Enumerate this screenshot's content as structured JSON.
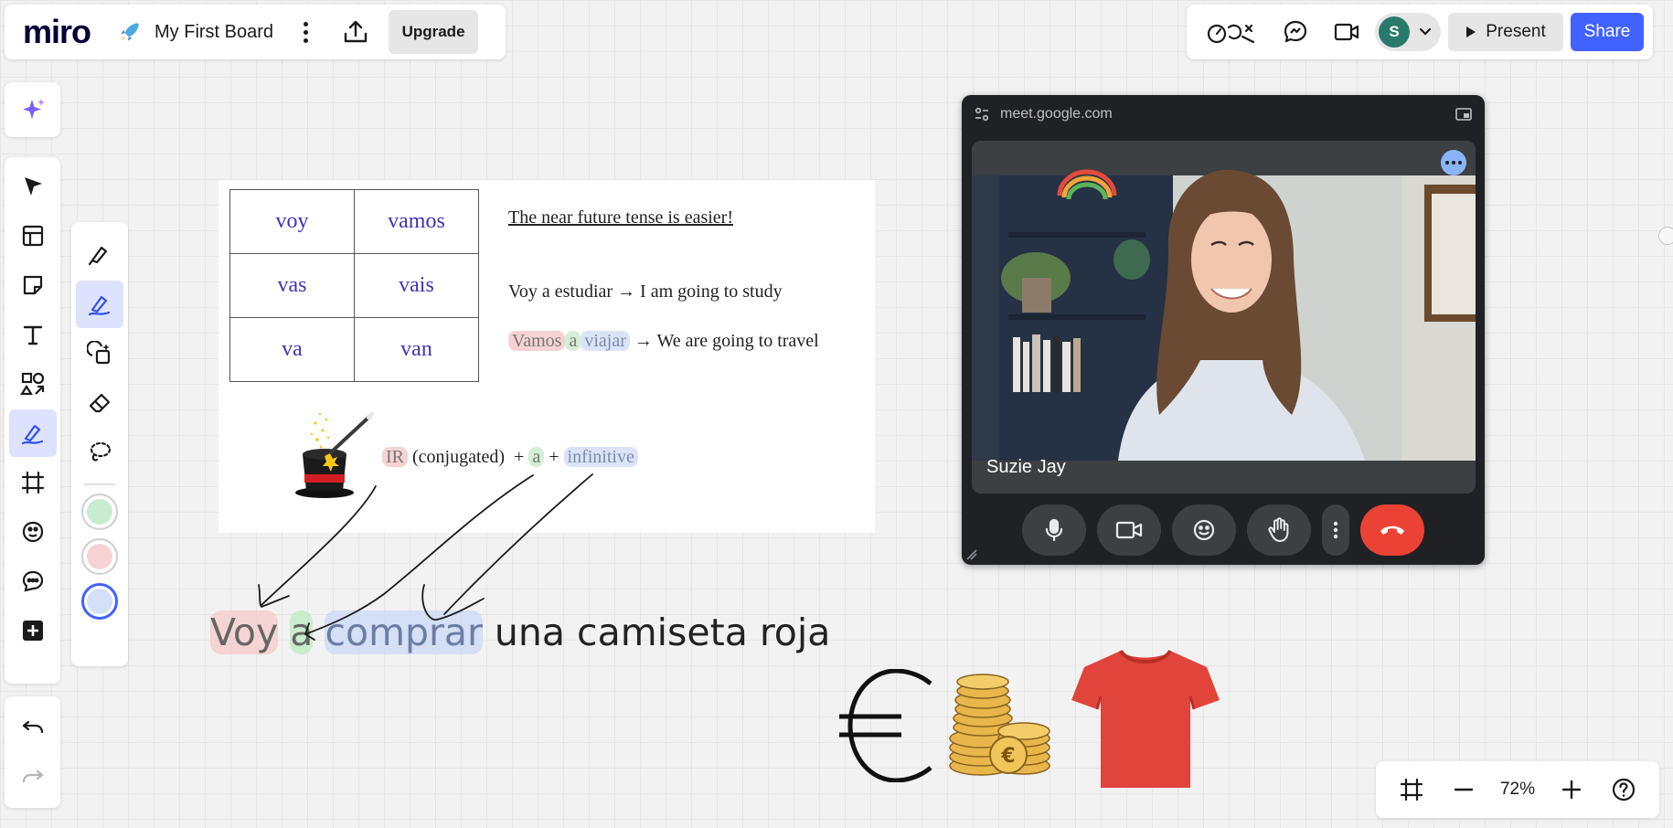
{
  "app": {
    "logo": "miro",
    "board_name": "My First Board",
    "upgrade_label": "Upgrade"
  },
  "header_right": {
    "avatar_initial": "S",
    "present_label": "Present",
    "share_label": "Share"
  },
  "lesson": {
    "table": [
      [
        "voy",
        "vamos"
      ],
      [
        "vas",
        "vais"
      ],
      [
        "va",
        "van"
      ]
    ],
    "title": "The near future tense is easier!",
    "example1": "Voy a estudiar → I am going to study",
    "example2_w1": "Vamos",
    "example2_w2": "a",
    "example2_w3": "viajar",
    "example2_rest": "→ We are going to travel",
    "formula_w1": "IR",
    "formula_mid": " (conjugated)  + ",
    "formula_w2": "a",
    "formula_plus": " + ",
    "formula_w3": "infinitive"
  },
  "sentence": {
    "w1": "Voy",
    "w2": "a",
    "w3": "comprar",
    "rest": " una camiseta roja"
  },
  "meet": {
    "url": "meet.google.com",
    "participant": "Suzie Jay"
  },
  "zoom": {
    "level": "72%"
  },
  "colors": {
    "accent": "#4262ff",
    "swatch_green": "#c8ecd0",
    "swatch_red": "#f7d2d2",
    "swatch_blue": "#d4e0f7",
    "hangup": "#ea4335",
    "shirt": "#e0443b"
  }
}
